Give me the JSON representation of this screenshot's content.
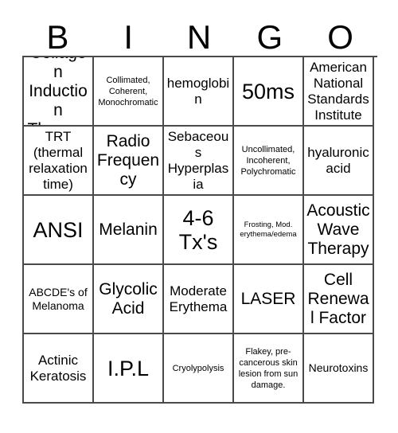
{
  "card": {
    "header_letters": [
      "B",
      "I",
      "N",
      "G",
      "O"
    ],
    "rows": [
      [
        {
          "text": "Collagen Induction Therapy",
          "size": "sz-lg"
        },
        {
          "text": "Collimated, Coherent, Monochromatic",
          "size": "sz-xs"
        },
        {
          "text": "hemoglobin",
          "size": "sz-md"
        },
        {
          "text": "50ms",
          "size": "sz-xl"
        },
        {
          "text": "American National Standards Institute",
          "size": "sz-md"
        }
      ],
      [
        {
          "text": "TRT (thermal relaxation time)",
          "size": "sz-md"
        },
        {
          "text": "Radio Frequency",
          "size": "sz-lg"
        },
        {
          "text": "Sebaceous Hyperplasia",
          "size": "sz-md"
        },
        {
          "text": "Uncollimated, Incoherent, Polychromatic",
          "size": "sz-xs"
        },
        {
          "text": "hyaluronic acid",
          "size": "sz-md"
        }
      ],
      [
        {
          "text": "ANSI",
          "size": "sz-xl"
        },
        {
          "text": "Melanin",
          "size": "sz-lg"
        },
        {
          "text": "4-6 Tx's",
          "size": "sz-xl"
        },
        {
          "text": "Frosting, Mod. erythema/edema",
          "size": "sz-xxs"
        },
        {
          "text": "Acoustic Wave Therapy",
          "size": "sz-lg"
        }
      ],
      [
        {
          "text": "ABCDE's of Melanoma",
          "size": "sz-sm"
        },
        {
          "text": "Glycolic Acid",
          "size": "sz-lg"
        },
        {
          "text": "Moderate Erythema",
          "size": "sz-md"
        },
        {
          "text": "LASER",
          "size": "sz-lg"
        },
        {
          "text": "Cell Renewal Factor",
          "size": "sz-lg"
        }
      ],
      [
        {
          "text": "Actinic Keratosis",
          "size": "sz-md"
        },
        {
          "text": "I.P.L",
          "size": "sz-xl"
        },
        {
          "text": "Cryolypolysis",
          "size": "sz-xs"
        },
        {
          "text": "Flakey, pre-cancerous skin lesion from sun damage.",
          "size": "sz-xs"
        },
        {
          "text": "Neurotoxins",
          "size": "sz-sm"
        }
      ]
    ]
  }
}
